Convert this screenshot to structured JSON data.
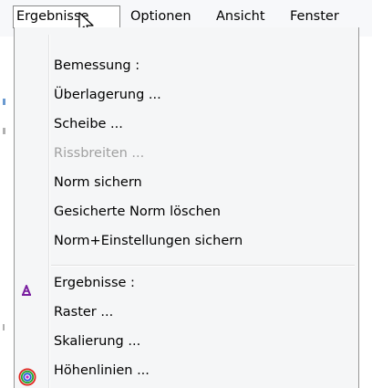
{
  "menubar": {
    "items": [
      {
        "label": "Ergebnisse",
        "active": true
      },
      {
        "label": "Optionen",
        "active": false
      },
      {
        "label": "Ansicht",
        "active": false
      },
      {
        "label": "Fenster",
        "active": false
      }
    ]
  },
  "dropdown": {
    "group1": {
      "header": "Bemessung :",
      "items": [
        {
          "label": "Überlagerung ...",
          "enabled": true
        },
        {
          "label": "Scheibe ...",
          "enabled": true
        },
        {
          "label": "Rissbreiten ...",
          "enabled": false
        },
        {
          "label": "Norm sichern",
          "enabled": true
        },
        {
          "label": "Gesicherte Norm löschen",
          "enabled": true
        },
        {
          "label": "Norm+Einstellungen sichern",
          "enabled": true
        }
      ]
    },
    "group2": {
      "header": "Ergebnisse :",
      "items": [
        {
          "label": "Raster ...",
          "enabled": true,
          "icon": "raster-icon"
        },
        {
          "label": "Skalierung ...",
          "enabled": true
        },
        {
          "label": "Höhenlinien ...",
          "enabled": true,
          "icon": "contour-lines-icon"
        }
      ]
    }
  },
  "colors": {
    "menu_background": "#f5f6f7",
    "disabled_text": "#a0a0a0",
    "raster_icon": "#7a1fa0"
  }
}
